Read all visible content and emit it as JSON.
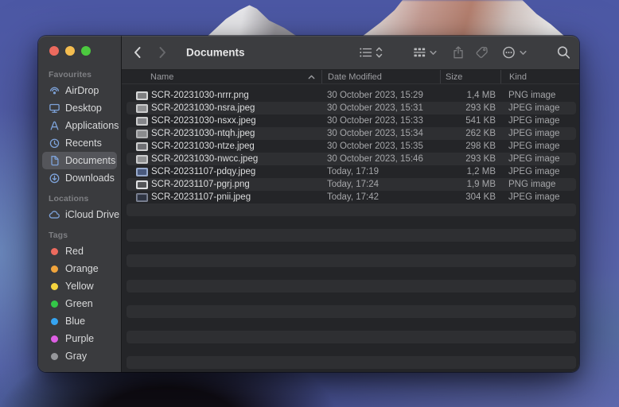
{
  "window": {
    "toolbar": {
      "title": "Documents",
      "back": "back",
      "forward": "forward",
      "view_control": "list-view",
      "group_control": "group-by",
      "share": "share",
      "tag": "tag",
      "more": "more-options",
      "search": "search"
    },
    "sidebar": {
      "selected_item": "Documents",
      "sections": [
        {
          "label": "Favourites",
          "items": [
            {
              "label": "AirDrop",
              "icon": "airdrop-icon"
            },
            {
              "label": "Desktop",
              "icon": "desktop-icon"
            },
            {
              "label": "Applications",
              "icon": "applications-icon"
            },
            {
              "label": "Recents",
              "icon": "recents-icon"
            },
            {
              "label": "Documents",
              "icon": "document-icon"
            },
            {
              "label": "Downloads",
              "icon": "downloads-icon"
            }
          ]
        },
        {
          "label": "Locations",
          "items": [
            {
              "label": "iCloud Drive",
              "icon": "cloud-icon"
            }
          ]
        },
        {
          "label": "Tags",
          "items": [
            {
              "label": "Red",
              "tag_color": "#ec6a5e"
            },
            {
              "label": "Orange",
              "tag_color": "#f0a43c"
            },
            {
              "label": "Yellow",
              "tag_color": "#f5d43e"
            },
            {
              "label": "Green",
              "tag_color": "#33c748"
            },
            {
              "label": "Blue",
              "tag_color": "#35a4f1"
            },
            {
              "label": "Purple",
              "tag_color": "#de5fe4"
            },
            {
              "label": "Gray",
              "tag_color": "#96979b"
            }
          ]
        }
      ]
    },
    "file_list": {
      "columns": [
        "Name",
        "Date Modified",
        "Size",
        "Kind"
      ],
      "sort": {
        "column": "Name",
        "direction": "ascending"
      },
      "rows": [
        {
          "name": "SCR-20231030-nrrr.png",
          "date": "30 October 2023, 15:29",
          "size": "1,4 MB",
          "kind": "PNG image",
          "thumb": "#d2d3d4",
          "thumb_inner": "#7e7f81"
        },
        {
          "name": "SCR-20231030-nsra.jpeg",
          "date": "30 October 2023, 15:31",
          "size": "293 KB",
          "kind": "JPEG image",
          "thumb": "#c7c8c9",
          "thumb_inner": "#909193"
        },
        {
          "name": "SCR-20231030-nsxx.jpeg",
          "date": "30 October 2023, 15:33",
          "size": "541 KB",
          "kind": "JPEG image",
          "thumb": "#c7c8c9",
          "thumb_inner": "#85868a"
        },
        {
          "name": "SCR-20231030-ntqh.jpeg",
          "date": "30 October 2023, 15:34",
          "size": "262 KB",
          "kind": "JPEG image",
          "thumb": "#aeafb1",
          "thumb_inner": "#8b8c8e"
        },
        {
          "name": "SCR-20231030-ntze.jpeg",
          "date": "30 October 2023, 15:35",
          "size": "298 KB",
          "kind": "JPEG image",
          "thumb": "#c7c8c9",
          "thumb_inner": "#6f7074"
        },
        {
          "name": "SCR-20231030-nwcc.jpeg",
          "date": "30 October 2023, 15:46",
          "size": "293 KB",
          "kind": "JPEG image",
          "thumb": "#c7c8c9",
          "thumb_inner": "#909193"
        },
        {
          "name": "SCR-20231107-pdqy.jpeg",
          "date": "Today, 17:19",
          "size": "1,2 MB",
          "kind": "JPEG image",
          "thumb": "#8fa3c8",
          "thumb_inner": "#4a5a7e"
        },
        {
          "name": "SCR-20231107-pgrj.png",
          "date": "Today, 17:24",
          "size": "1,9 MB",
          "kind": "PNG image",
          "thumb": "#dcdddf",
          "thumb_inner": "#555659"
        },
        {
          "name": "SCR-20231107-pnii.jpeg",
          "date": "Today, 17:42",
          "size": "304 KB",
          "kind": "JPEG image",
          "thumb": "#6a7184",
          "thumb_inner": "#2e3442"
        }
      ],
      "empty_row_count": 14
    }
  },
  "colors": {
    "traffic_red": "#ec6a5e",
    "traffic_yellow": "#f4bd50",
    "traffic_green": "#4cc93f",
    "sidebar_accent_blue": "#7da2d9",
    "stripe": "#2e2f32",
    "sidebar_bg": "#3a3b3e"
  }
}
